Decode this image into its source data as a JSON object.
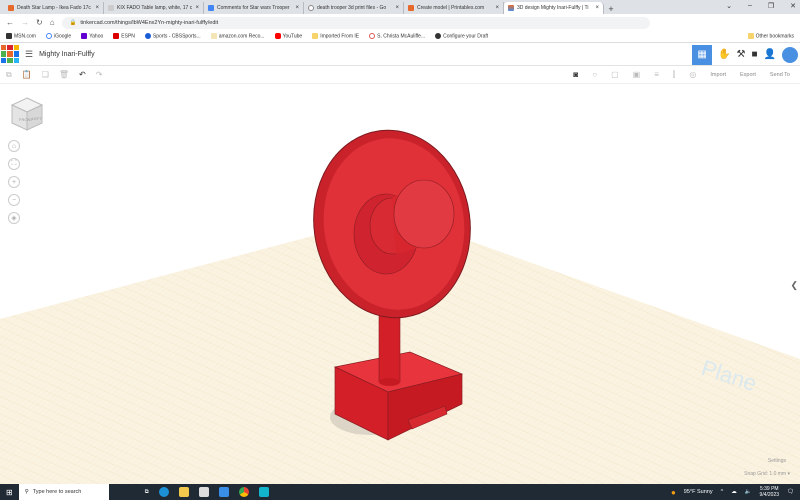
{
  "browser": {
    "tabs": [
      {
        "title": "Death Star Lamp - Ikea Fado 17c",
        "color": "#e8692c",
        "active": false
      },
      {
        "title": "KIX FADO Table lamp, white, 17 cm",
        "color": "#dcdcdc",
        "active": false
      },
      {
        "title": "Comments for Star wars Trooper",
        "color": "#4285f4",
        "active": false
      },
      {
        "title": "death trooper 3d print files - Go",
        "color": "#ffffff",
        "active": false
      },
      {
        "title": "Create model | Printables.com",
        "color": "#e8692c",
        "active": false
      },
      {
        "title": "3D design Mighty Inari-Fulffy | Ti",
        "color": "#e8692c",
        "active": true
      }
    ],
    "url": "tinkercad.com/things/lbW4Enx2Yn-mighty-inari-fulffy/edit",
    "bookmarks": [
      "MSN.com",
      "iGoogle",
      "Yahoo",
      "ESPN",
      "Sports - CBSSports...",
      "amazon.com Reco...",
      "YouTube",
      "Imported From IE",
      "S. Christa McAuliffe...",
      "Configure your Draft"
    ],
    "other_bookmarks": "Other bookmarks"
  },
  "app": {
    "title": "Mighty Inari-Fulffy",
    "actions": {
      "import": "Import",
      "export": "Export",
      "send_to": "Send To"
    },
    "settings": "Settings",
    "snap_grid_label": "Snap Grid",
    "snap_grid_value": "1.0 mm",
    "plane_text": "Plane",
    "viewcube": {
      "top": "TOP",
      "front": "FRONT",
      "left": "LEFT"
    }
  },
  "taskbar": {
    "search_placeholder": "Type here to search",
    "weather": "95°F Sunny",
    "time": "5:39 PM",
    "date": "9/4/2023"
  },
  "colors": {
    "accent": "#4a90e2",
    "model": "#d9232d",
    "plate": "#fbf3e1"
  }
}
